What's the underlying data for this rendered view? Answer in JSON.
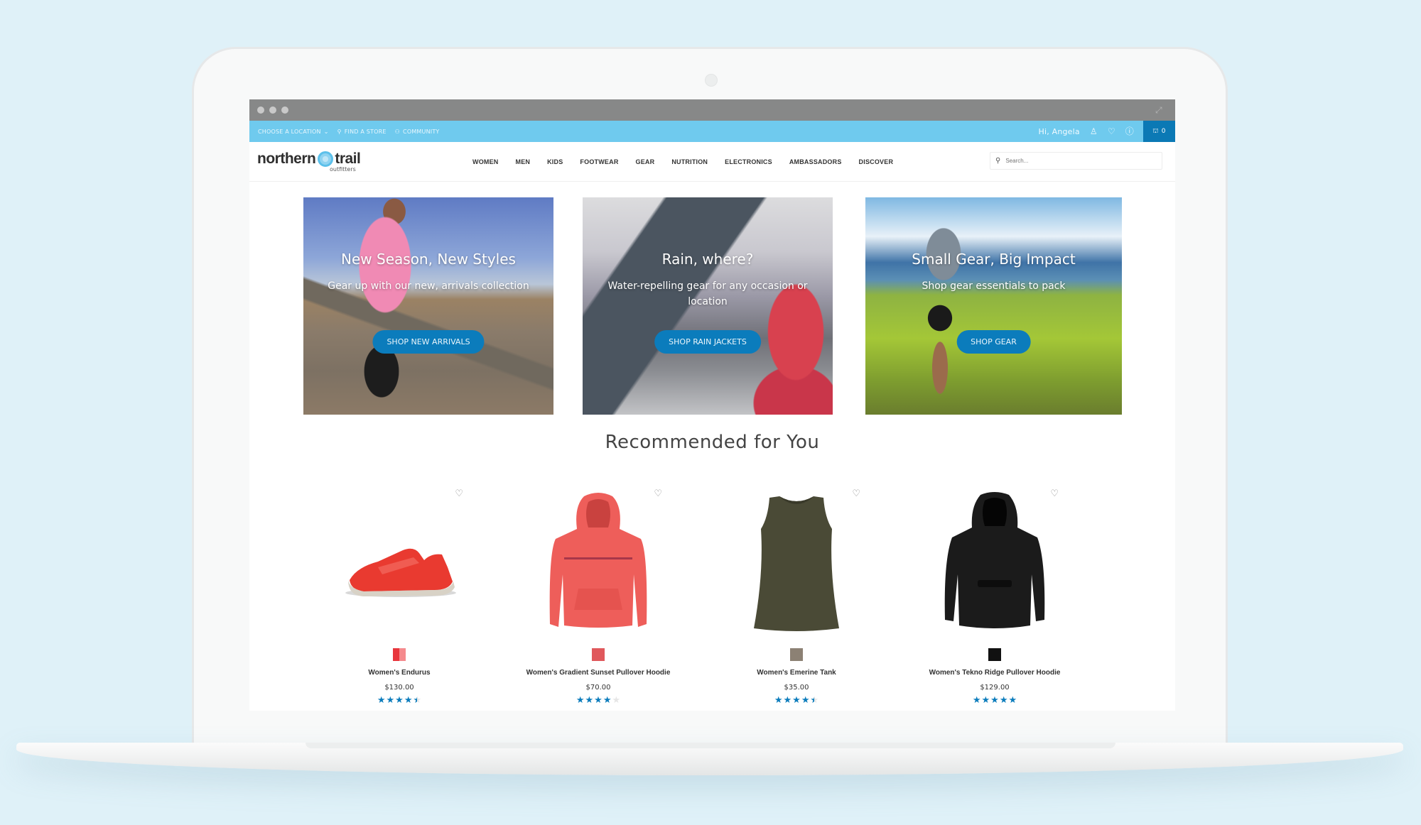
{
  "browser": {
    "window_dots": 3
  },
  "utility_bar": {
    "choose_location": "CHOOSE A LOCATION",
    "find_store": "FIND A STORE",
    "community": "COMMUNITY",
    "greeting": "Hi, Angela",
    "cart_count": "0",
    "colors": {
      "bar": "#6fcaee",
      "cart": "#0b79b5"
    }
  },
  "header": {
    "logo_main_left": "northern",
    "logo_main_right": "trail",
    "logo_sub": "outfitters",
    "nav": [
      "WOMEN",
      "MEN",
      "KIDS",
      "FOOTWEAR",
      "GEAR",
      "NUTRITION",
      "ELECTRONICS",
      "AMBASSADORS",
      "DISCOVER"
    ],
    "search_placeholder": "Search..."
  },
  "heroes": [
    {
      "title": "New Season, New Styles",
      "subtitle": "Gear up with our new, arrivals collection",
      "button": "SHOP NEW ARRIVALS"
    },
    {
      "title": "Rain, where?",
      "subtitle": "Water-repelling gear for any occasion or location",
      "button": "SHOP RAIN JACKETS"
    },
    {
      "title": "Small Gear, Big Impact",
      "subtitle": "Shop gear essentials to pack",
      "button": "SHOP GEAR"
    }
  ],
  "recommended": {
    "title": "Recommended for You",
    "products": [
      {
        "name": "Women's Endurus",
        "price": "$130.00",
        "rating": 4.5,
        "swatch": "#e8363d",
        "swatch2": "#f58a8d",
        "image": "red-sneakers"
      },
      {
        "name": "Women's Gradient Sunset Pullover Hoodie",
        "price": "$70.00",
        "rating": 4,
        "swatch": "#e0585c",
        "image": "coral-hoodie"
      },
      {
        "name": "Women's Emerine Tank",
        "price": "$35.00",
        "rating": 4.5,
        "swatch": "#8c8174",
        "image": "olive-tank"
      },
      {
        "name": "Women's Tekno Ridge Pullover Hoodie",
        "price": "$129.00",
        "rating": 5,
        "swatch": "#111111",
        "image": "black-hoodie"
      }
    ]
  },
  "accent_color": "#0b7cbc"
}
